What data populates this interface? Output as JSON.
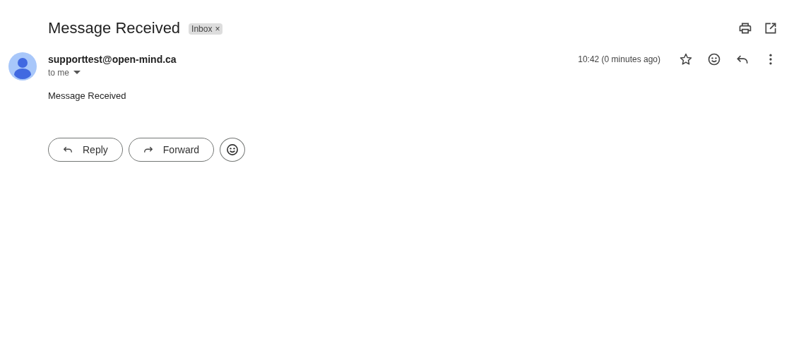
{
  "subject": "Message Received",
  "label": {
    "text": "Inbox",
    "remove": "×"
  },
  "sender": "supporttest@open-mind.ca",
  "recipient": "to me",
  "time": "10:42 (0 minutes ago)",
  "starred": false,
  "body": "Message Received",
  "actions": [
    {
      "kind": "reply",
      "label": "Reply"
    },
    {
      "kind": "forward",
      "label": "Forward"
    },
    {
      "kind": "emoji"
    }
  ]
}
